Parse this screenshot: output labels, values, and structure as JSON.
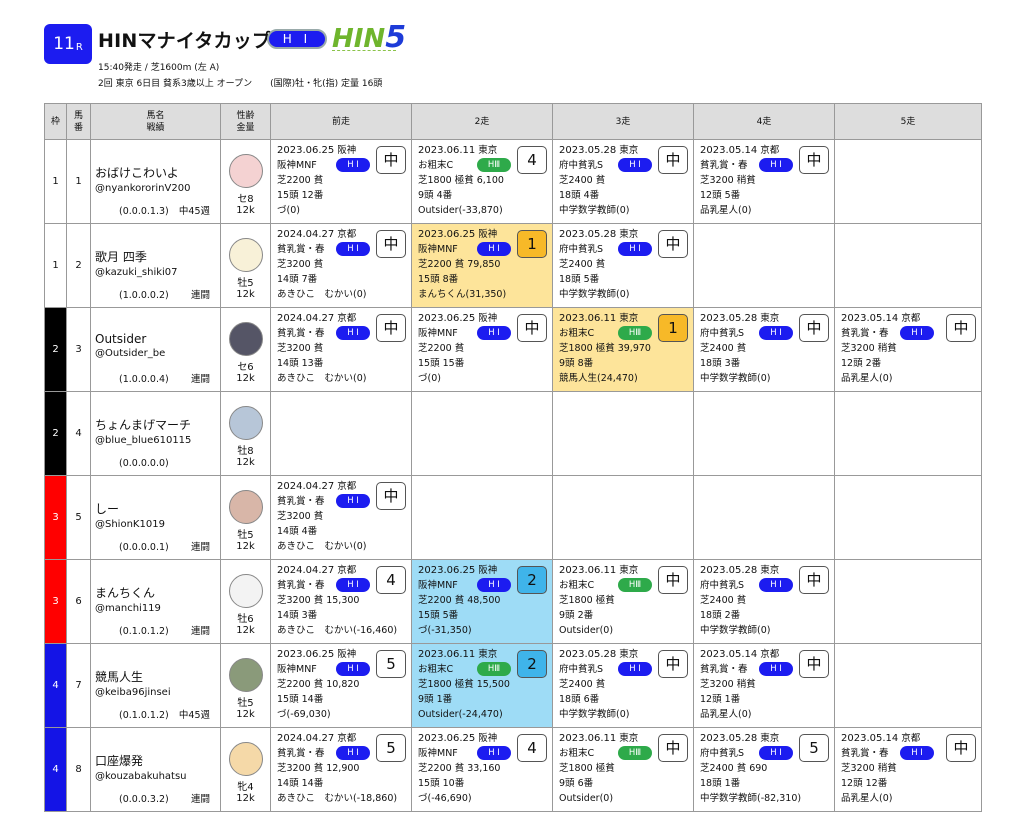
{
  "race": {
    "number": "11",
    "r_suffix": "R",
    "name": "HINマナイタカップ",
    "grade": "H I",
    "logo_a": "HIN",
    "logo_b": "5",
    "line1": "15:40発走 / 芝1600m (左 A)",
    "line2": "2回 東京 6日目 貧系3歳以上 オープン　　(国際)牡・牝(指) 定量 16頭"
  },
  "headers": {
    "waku": "枠",
    "uma": "馬\n番",
    "name": "馬名\n戦績",
    "sex": "性齢\n金量",
    "r1": "前走",
    "r2": "2走",
    "r3": "3走",
    "r4": "4走",
    "r5": "5走"
  },
  "horses": [
    {
      "waku": "1",
      "waku_color": "#ffffff",
      "uma": "1",
      "name": "おばけこわいよ",
      "user": "@nyankororinV200",
      "record": "(0.0.0.1.3)",
      "note": "中45週",
      "sex": "セ8",
      "kin": "12k",
      "avatar_color": "#f4d2d2",
      "runs": [
        {
          "date": "2023.06.25",
          "place": "阪神",
          "race": "阪神MNF",
          "grade": "H I",
          "grade_cls": "hi",
          "cond": "芝2200 貧",
          "field": "15頭 12番",
          "jockey": "づ(0)",
          "pos": "中",
          "hl": ""
        },
        {
          "date": "2023.06.11",
          "place": "東京",
          "race": "お粗末C",
          "grade": "HⅢ",
          "grade_cls": "h3",
          "cond": "芝1800 極貧 6,100",
          "field": "9頭 4番",
          "jockey": "Outsider(-33,870)",
          "pos": "4",
          "hl": ""
        },
        {
          "date": "2023.05.28",
          "place": "東京",
          "race": "府中貧乳S",
          "grade": "H I",
          "grade_cls": "hi",
          "cond": "芝2400 貧",
          "field": "18頭 4番",
          "jockey": "中学数学教師(0)",
          "pos": "中",
          "hl": ""
        },
        {
          "date": "2023.05.14",
          "place": "京都",
          "race": "貧乳賞・春",
          "grade": "H I",
          "grade_cls": "hi",
          "cond": "芝3200 稍貧",
          "field": "12頭 5番",
          "jockey": "品乳星人(0)",
          "pos": "中",
          "hl": ""
        },
        null
      ]
    },
    {
      "waku": "1",
      "waku_color": "#ffffff",
      "uma": "2",
      "name": "歌月 四季",
      "user": "@kazuki_shiki07",
      "record": "(1.0.0.0.2)",
      "note": "連闘",
      "sex": "牡5",
      "kin": "12k",
      "avatar_color": "#f8f1d8",
      "runs": [
        {
          "date": "2024.04.27",
          "place": "京都",
          "race": "貧乳賞・春",
          "grade": "H I",
          "grade_cls": "hi",
          "cond": "芝3200 貧",
          "field": "14頭 7番",
          "jockey": "あきひこ　むかい(0)",
          "pos": "中",
          "hl": ""
        },
        {
          "date": "2023.06.25",
          "place": "阪神",
          "race": "阪神MNF",
          "grade": "H I",
          "grade_cls": "hi",
          "cond": "芝2200 貧 79,850",
          "field": "15頭 8番",
          "jockey": "まんちくん(31,350)",
          "pos": "1",
          "hl": "gold"
        },
        {
          "date": "2023.05.28",
          "place": "東京",
          "race": "府中貧乳S",
          "grade": "H I",
          "grade_cls": "hi",
          "cond": "芝2400 貧",
          "field": "18頭 5番",
          "jockey": "中学数学教師(0)",
          "pos": "中",
          "hl": ""
        },
        null,
        null
      ]
    },
    {
      "waku": "2",
      "waku_color": "#000000",
      "uma": "3",
      "name": "Outsider",
      "user": "@Outsider_be",
      "record": "(1.0.0.0.4)",
      "note": "連闘",
      "sex": "セ6",
      "kin": "12k",
      "avatar_color": "#555566",
      "runs": [
        {
          "date": "2024.04.27",
          "place": "京都",
          "race": "貧乳賞・春",
          "grade": "H I",
          "grade_cls": "hi",
          "cond": "芝3200 貧",
          "field": "14頭 13番",
          "jockey": "あきひこ　むかい(0)",
          "pos": "中",
          "hl": ""
        },
        {
          "date": "2023.06.25",
          "place": "阪神",
          "race": "阪神MNF",
          "grade": "H I",
          "grade_cls": "hi",
          "cond": "芝2200 貧",
          "field": "15頭 15番",
          "jockey": "づ(0)",
          "pos": "中",
          "hl": ""
        },
        {
          "date": "2023.06.11",
          "place": "東京",
          "race": "お粗末C",
          "grade": "HⅢ",
          "grade_cls": "h3",
          "cond": "芝1800 極貧 39,970",
          "field": "9頭 8番",
          "jockey": "競馬人生(24,470)",
          "pos": "1",
          "hl": "gold"
        },
        {
          "date": "2023.05.28",
          "place": "東京",
          "race": "府中貧乳S",
          "grade": "H I",
          "grade_cls": "hi",
          "cond": "芝2400 貧",
          "field": "18頭 3番",
          "jockey": "中学数学教師(0)",
          "pos": "中",
          "hl": ""
        },
        {
          "date": "2023.05.14",
          "place": "京都",
          "race": "貧乳賞・春",
          "grade": "H I",
          "grade_cls": "hi",
          "cond": "芝3200 稍貧",
          "field": "12頭 2番",
          "jockey": "品乳星人(0)",
          "pos": "中",
          "hl": ""
        }
      ]
    },
    {
      "waku": "2",
      "waku_color": "#000000",
      "uma": "4",
      "name": "ちょんまげマーチ",
      "user": "@blue_blue610115",
      "record": "(0.0.0.0.0)",
      "note": "",
      "sex": "牡8",
      "kin": "12k",
      "avatar_color": "#b7c6d8",
      "runs": [
        null,
        null,
        null,
        null,
        null
      ]
    },
    {
      "waku": "3",
      "waku_color": "#ff0000",
      "uma": "5",
      "name": "しー",
      "user": "@ShionK1019",
      "record": "(0.0.0.0.1)",
      "note": "連闘",
      "sex": "牡5",
      "kin": "12k",
      "avatar_color": "#d8b6a8",
      "runs": [
        {
          "date": "2024.04.27",
          "place": "京都",
          "race": "貧乳賞・春",
          "grade": "H I",
          "grade_cls": "hi",
          "cond": "芝3200 貧",
          "field": "14頭 4番",
          "jockey": "あきひこ　むかい(0)",
          "pos": "中",
          "hl": ""
        },
        null,
        null,
        null,
        null
      ]
    },
    {
      "waku": "3",
      "waku_color": "#ff0000",
      "uma": "6",
      "name": "まんちくん",
      "user": "@manchi119",
      "record": "(0.1.0.1.2)",
      "note": "連闘",
      "sex": "牡6",
      "kin": "12k",
      "avatar_color": "#f3f3f3",
      "runs": [
        {
          "date": "2024.04.27",
          "place": "京都",
          "race": "貧乳賞・春",
          "grade": "H I",
          "grade_cls": "hi",
          "cond": "芝3200 貧 15,300",
          "field": "14頭 3番",
          "jockey": "あきひこ　むかい(-16,460)",
          "pos": "4",
          "hl": ""
        },
        {
          "date": "2023.06.25",
          "place": "阪神",
          "race": "阪神MNF",
          "grade": "H I",
          "grade_cls": "hi",
          "cond": "芝2200 貧 48,500",
          "field": "15頭 5番",
          "jockey": "づ(-31,350)",
          "pos": "2",
          "hl": "cyan"
        },
        {
          "date": "2023.06.11",
          "place": "東京",
          "race": "お粗末C",
          "grade": "HⅢ",
          "grade_cls": "h3",
          "cond": "芝1800 極貧",
          "field": "9頭 2番",
          "jockey": "Outsider(0)",
          "pos": "中",
          "hl": ""
        },
        {
          "date": "2023.05.28",
          "place": "東京",
          "race": "府中貧乳S",
          "grade": "H I",
          "grade_cls": "hi",
          "cond": "芝2400 貧",
          "field": "18頭 2番",
          "jockey": "中学数学教師(0)",
          "pos": "中",
          "hl": ""
        },
        null
      ]
    },
    {
      "waku": "4",
      "waku_color": "#1414e6",
      "uma": "7",
      "name": "競馬人生",
      "user": "@keiba96jinsei",
      "record": "(0.1.0.1.2)",
      "note": "中45週",
      "sex": "牡5",
      "kin": "12k",
      "avatar_color": "#8a9a7a",
      "runs": [
        {
          "date": "2023.06.25",
          "place": "阪神",
          "race": "阪神MNF",
          "grade": "H I",
          "grade_cls": "hi",
          "cond": "芝2200 貧 10,820",
          "field": "15頭 14番",
          "jockey": "づ(-69,030)",
          "pos": "5",
          "hl": ""
        },
        {
          "date": "2023.06.11",
          "place": "東京",
          "race": "お粗末C",
          "grade": "HⅢ",
          "grade_cls": "h3",
          "cond": "芝1800 極貧 15,500",
          "field": "9頭 1番",
          "jockey": "Outsider(-24,470)",
          "pos": "2",
          "hl": "cyan"
        },
        {
          "date": "2023.05.28",
          "place": "東京",
          "race": "府中貧乳S",
          "grade": "H I",
          "grade_cls": "hi",
          "cond": "芝2400 貧",
          "field": "18頭 6番",
          "jockey": "中学数学教師(0)",
          "pos": "中",
          "hl": ""
        },
        {
          "date": "2023.05.14",
          "place": "京都",
          "race": "貧乳賞・春",
          "grade": "H I",
          "grade_cls": "hi",
          "cond": "芝3200 稍貧",
          "field": "12頭 1番",
          "jockey": "品乳星人(0)",
          "pos": "中",
          "hl": ""
        },
        null
      ]
    },
    {
      "waku": "4",
      "waku_color": "#1414e6",
      "uma": "8",
      "name": "口座爆発",
      "user": "@kouzabakuhatsu",
      "record": "(0.0.0.3.2)",
      "note": "連闘",
      "sex": "牝4",
      "kin": "12k",
      "avatar_color": "#f5d9a8",
      "runs": [
        {
          "date": "2024.04.27",
          "place": "京都",
          "race": "貧乳賞・春",
          "grade": "H I",
          "grade_cls": "hi",
          "cond": "芝3200 貧 12,900",
          "field": "14頭 14番",
          "jockey": "あきひこ　むかい(-18,860)",
          "pos": "5",
          "hl": ""
        },
        {
          "date": "2023.06.25",
          "place": "阪神",
          "race": "阪神MNF",
          "grade": "H I",
          "grade_cls": "hi",
          "cond": "芝2200 貧 33,160",
          "field": "15頭 10番",
          "jockey": "づ(-46,690)",
          "pos": "4",
          "hl": ""
        },
        {
          "date": "2023.06.11",
          "place": "東京",
          "race": "お粗末C",
          "grade": "HⅢ",
          "grade_cls": "h3",
          "cond": "芝1800 極貧",
          "field": "9頭 6番",
          "jockey": "Outsider(0)",
          "pos": "中",
          "hl": ""
        },
        {
          "date": "2023.05.28",
          "place": "東京",
          "race": "府中貧乳S",
          "grade": "H I",
          "grade_cls": "hi",
          "cond": "芝2400 貧 690",
          "field": "18頭 1番",
          "jockey": "中学数学教師(-82,310)",
          "pos": "5",
          "hl": ""
        },
        {
          "date": "2023.05.14",
          "place": "京都",
          "race": "貧乳賞・春",
          "grade": "H I",
          "grade_cls": "hi",
          "cond": "芝3200 稍貧",
          "field": "12頭 12番",
          "jockey": "品乳星人(0)",
          "pos": "中",
          "hl": ""
        }
      ]
    }
  ]
}
